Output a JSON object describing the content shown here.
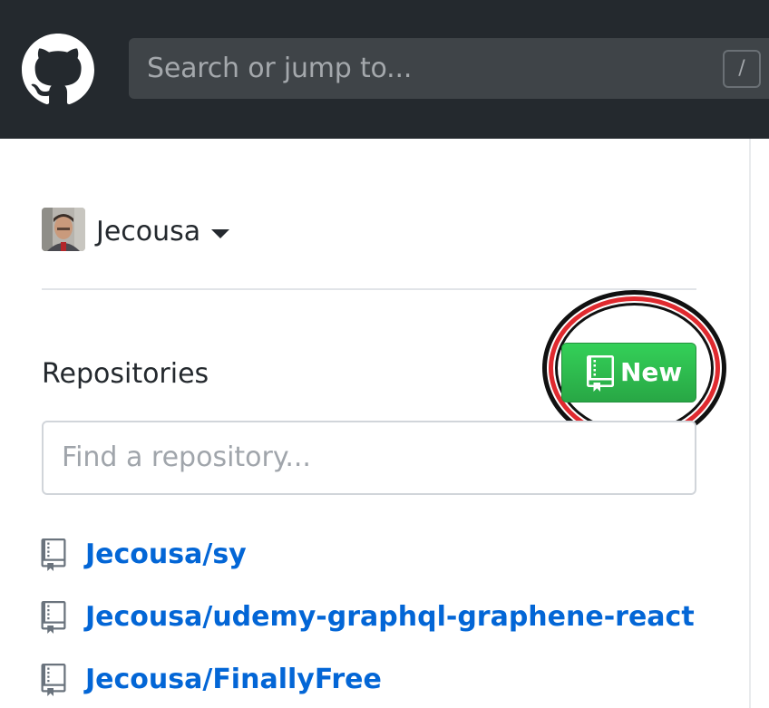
{
  "header": {
    "logo_icon": "github-octocat-icon",
    "search": {
      "placeholder": "Search or jump to...",
      "shortcut_key": "/"
    }
  },
  "sidebar": {
    "user": {
      "name": "Jecousa",
      "avatar_icon": "user-avatar"
    },
    "repositories": {
      "title": "Repositories",
      "new_button_label": "New",
      "new_button_icon": "repo-book-icon",
      "find_placeholder": "Find a repository...",
      "items": [
        {
          "name": "Jecousa/sy"
        },
        {
          "name": "Jecousa/udemy-graphql-graphene-react"
        },
        {
          "name": "Jecousa/FinallyFree"
        }
      ]
    }
  },
  "colors": {
    "header_bg": "#24292e",
    "new_button": "#2cbe4e",
    "link": "#0366d6",
    "highlight_ring": "#e02a2f"
  }
}
